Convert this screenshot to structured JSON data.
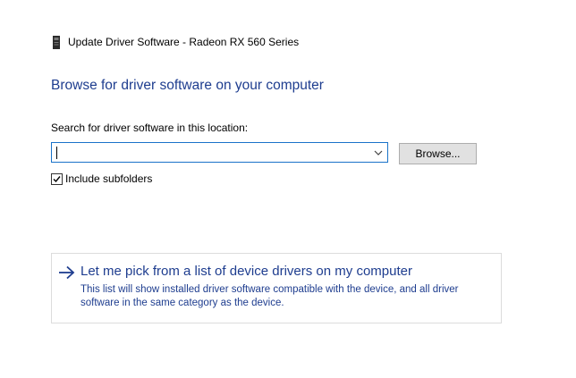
{
  "window": {
    "title": "Update Driver Software - Radeon RX 560 Series",
    "icon": "device-icon"
  },
  "heading": "Browse for driver software on your computer",
  "search": {
    "label": "Search for driver software in this location:",
    "value": "",
    "browse_label": "Browse..."
  },
  "subfolders": {
    "label": "Include subfolders",
    "checked": true
  },
  "pick_option": {
    "title": "Let me pick from a list of device drivers on my computer",
    "description": "This list will show installed driver software compatible with the device, and all driver software in the same category as the device.",
    "icon": "right-arrow-icon"
  },
  "colors": {
    "accent": "#1e3d8f",
    "focus_border": "#1a73c9",
    "button_face": "#e1e1e1"
  }
}
